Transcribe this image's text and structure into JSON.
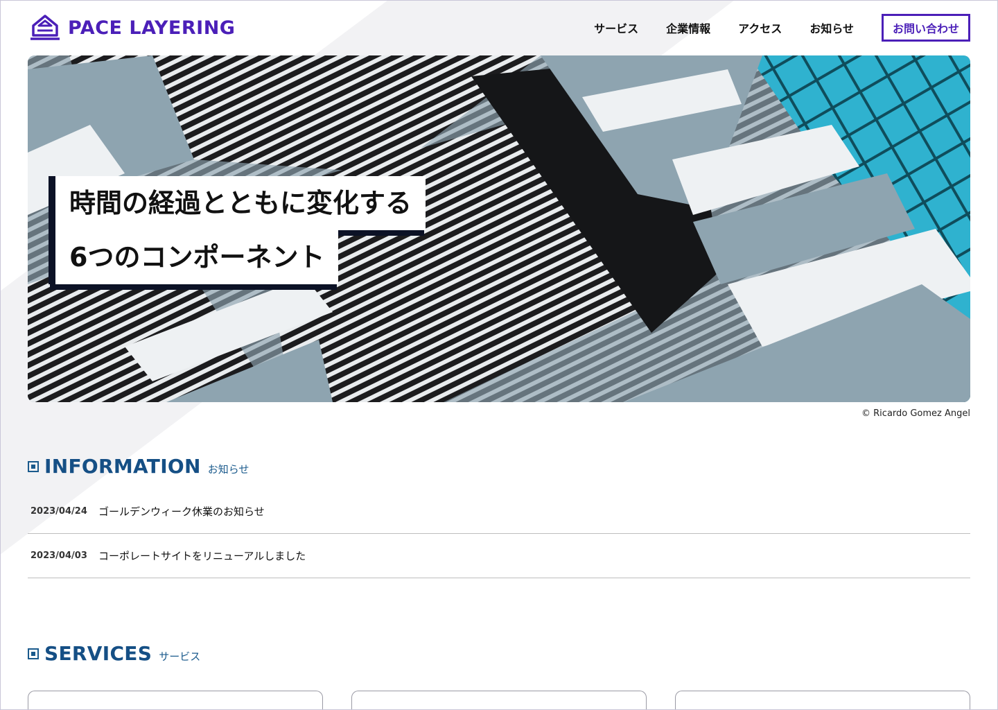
{
  "brand": {
    "name": "PACE LAYERING",
    "color": "#4b1fb8"
  },
  "nav": {
    "items": [
      {
        "label": "サービス"
      },
      {
        "label": "企業情報"
      },
      {
        "label": "アクセス"
      },
      {
        "label": "お知らせ"
      }
    ],
    "contact_label": "お問い合わせ"
  },
  "hero": {
    "title_line1": "時間の経過とともに変化する",
    "title_line2": "6つのコンポーネント",
    "credit": "© Ricardo Gomez Angel"
  },
  "information": {
    "heading_en": "INFORMATION",
    "heading_ja": "お知らせ",
    "items": [
      {
        "date": "2023/04/24",
        "title": "ゴールデンウィーク休業のお知らせ"
      },
      {
        "date": "2023/04/03",
        "title": "コーポレートサイトをリニューアルしました"
      }
    ]
  },
  "services": {
    "heading_en": "SERVICES",
    "heading_ja": "サービス"
  },
  "colors": {
    "accent": "#4b1fb8",
    "heading": "#154f85",
    "title_shadow": "#0c1226"
  }
}
